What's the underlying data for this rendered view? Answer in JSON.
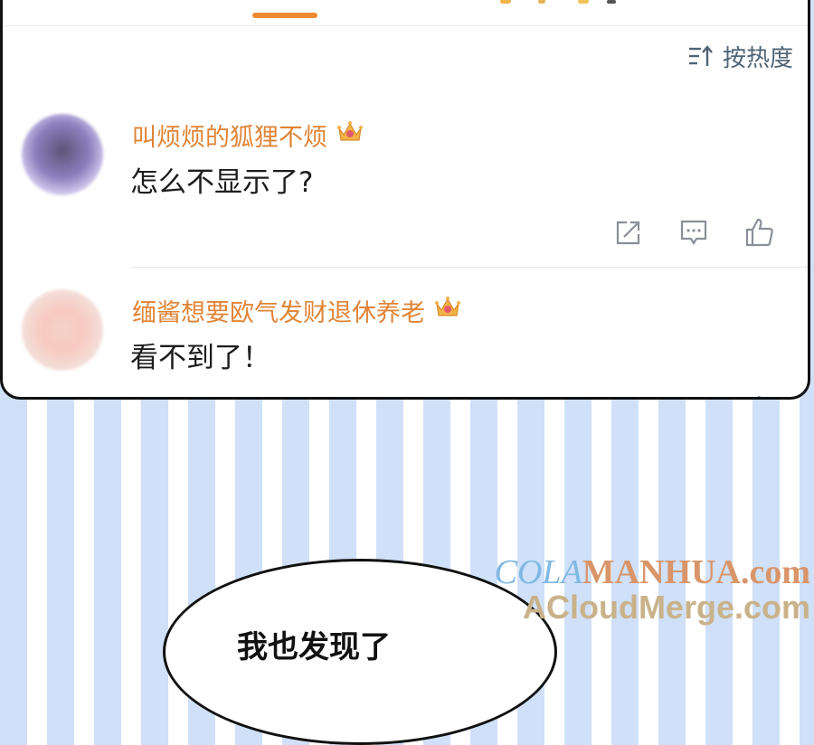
{
  "header": {
    "sort_label": "按热度"
  },
  "comments": [
    {
      "username": "叫烦烦的狐狸不烦",
      "text": "怎么不显示了?",
      "badge": "crown-icon"
    },
    {
      "username": "缅酱想要欧气发财退休养老",
      "text": "看不到了！",
      "badge": "crown-icon"
    }
  ],
  "background": {
    "bubble_text": "我也发现了"
  },
  "watermark": {
    "line1_a": "COLA",
    "line1_b": "MANHUA.com",
    "line2": "ACloudMerge.com"
  },
  "colors": {
    "accent": "#f08a32",
    "username": "#e08436",
    "icon_gray": "#8a8f98",
    "stripe_blue": "#cfe0f8"
  }
}
